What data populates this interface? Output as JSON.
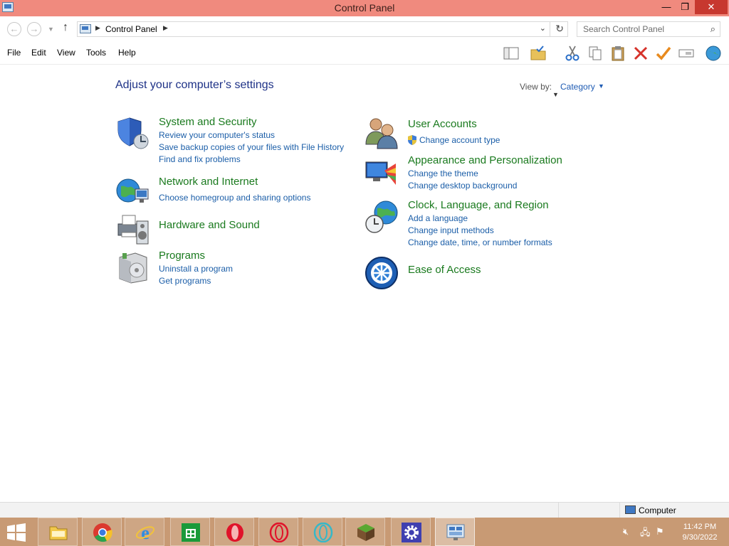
{
  "window": {
    "title": "Control Panel",
    "minimize": "—",
    "maximize": "❐",
    "close": "✕"
  },
  "address": {
    "breadcrumb": "Control Panel",
    "search_placeholder": "Search Control Panel"
  },
  "menu": {
    "items": [
      "File",
      "Edit",
      "View",
      "Tools",
      "Help"
    ]
  },
  "toolbar_icons": [
    "layout-icon",
    "folder-check-icon",
    "cut-icon",
    "copy-icon",
    "paste-icon",
    "delete-icon",
    "checkmark-icon",
    "rename-icon",
    "globe-icon"
  ],
  "content": {
    "heading": "Adjust your computer’s settings",
    "view_by_label": "View by:",
    "view_by_value": "Category",
    "left_categories": [
      {
        "title": "System and Security",
        "icon": "shield-icon",
        "links": [
          "Review your computer's status",
          "Save backup copies of your files with File History",
          "Find and fix problems"
        ]
      },
      {
        "title": "Network and Internet",
        "icon": "network-globe-icon",
        "links": [
          "Choose homegroup and sharing options"
        ]
      },
      {
        "title": "Hardware and Sound",
        "icon": "printer-speaker-icon",
        "links": []
      },
      {
        "title": "Programs",
        "icon": "programs-box-icon",
        "links": [
          "Uninstall a program",
          "Get programs"
        ]
      }
    ],
    "right_categories": [
      {
        "title": "User Accounts",
        "icon": "users-icon",
        "links": [
          "Change account type"
        ]
      },
      {
        "title": "Appearance and Personalization",
        "icon": "display-colors-icon",
        "links": [
          "Change the theme",
          "Change desktop background"
        ]
      },
      {
        "title": "Clock, Language, and Region",
        "icon": "clock-globe-icon",
        "links": [
          "Add a language",
          "Change input methods",
          "Change date, time, or number formats"
        ]
      },
      {
        "title": "Ease of Access",
        "icon": "ease-of-access-icon",
        "links": []
      }
    ]
  },
  "statusbar": {
    "location": "Computer"
  },
  "taskbar": {
    "apps": [
      "file-explorer-icon",
      "chrome-icon",
      "internet-explorer-icon",
      "store-icon",
      "opera-icon",
      "opera-outline-icon",
      "opera-teal-icon",
      "minecraft-icon",
      "settings-gear-icon",
      "control-panel-icon"
    ],
    "time": "11:42 PM",
    "date": "9/30/2022"
  },
  "colors": {
    "titlebar": "#f08a7e",
    "link": "#1b5ea8",
    "category_title": "#1a7a1e",
    "heading": "#1e3287",
    "taskbar": "#c89a74"
  }
}
